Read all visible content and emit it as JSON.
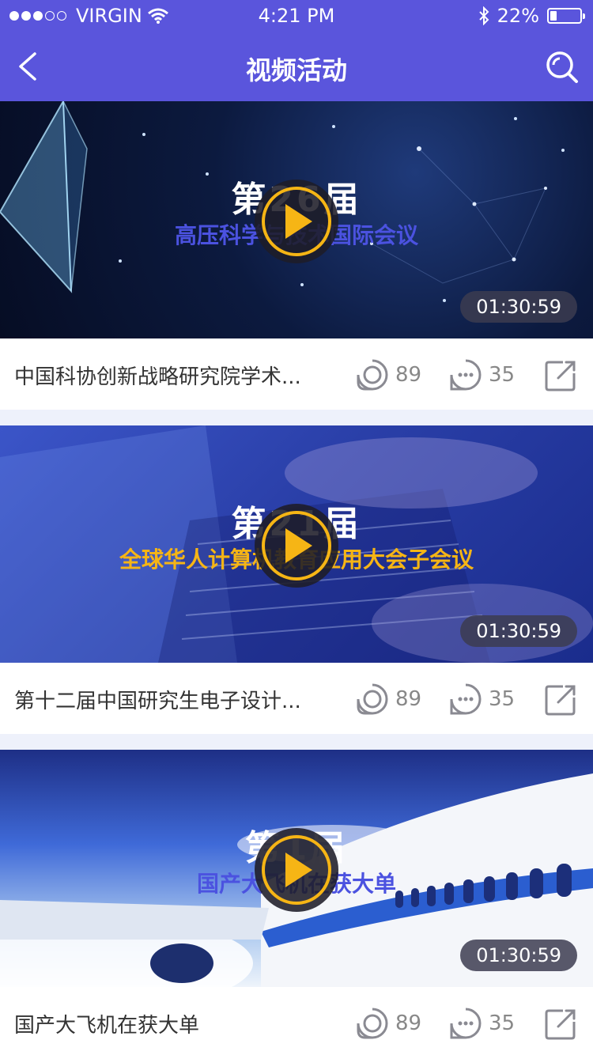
{
  "status_bar": {
    "carrier": "VIRGIN",
    "time": "4:21 PM",
    "battery": "22%",
    "battery_level": 0.22
  },
  "nav": {
    "title": "视频活动",
    "back_icon": "chevron-left-icon",
    "search_icon": "search-icon"
  },
  "videos": [
    {
      "overlay_number": "第26届",
      "overlay_subtitle": "高压科学与技术国际会议",
      "overlay_subtitle_color": "#4b52e0",
      "duration": "01:30:59",
      "title": "中国科协创新战略研究院学术...",
      "views": "89",
      "comments": "35"
    },
    {
      "overlay_number": "第21届",
      "overlay_subtitle": "全球华人计算机教育应用大会子会议",
      "overlay_subtitle_color": "#f6b515",
      "duration": "01:30:59",
      "title": "第十二届中国研究生电子设计...",
      "views": "89",
      "comments": "35"
    },
    {
      "overlay_number": "第1届",
      "overlay_subtitle": "国产大飞机在获大单",
      "overlay_subtitle_color": "#4b52e0",
      "duration": "01:30:59",
      "title": "国产大飞机在获大单",
      "views": "89",
      "comments": "35"
    }
  ]
}
